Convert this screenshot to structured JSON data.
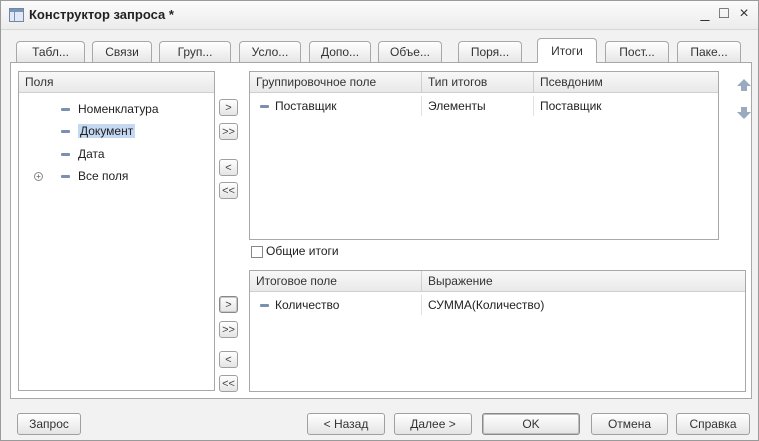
{
  "window": {
    "title": "Конструктор запроса *",
    "controls": {
      "minimize": "_",
      "maximize": "□",
      "close": "×"
    }
  },
  "tabs": [
    {
      "label": "Табл..."
    },
    {
      "label": "Связи"
    },
    {
      "label": "Груп..."
    },
    {
      "label": "Усло..."
    },
    {
      "label": "Допо..."
    },
    {
      "label": "Объе..."
    },
    {
      "label": "Поря..."
    },
    {
      "label": "Итоги"
    },
    {
      "label": "Пост..."
    },
    {
      "label": "Паке..."
    }
  ],
  "active_tab": "Итоги",
  "fields_panel": {
    "header": "Поля",
    "items": [
      {
        "label": "Номенклатура",
        "icon": "field-icon"
      },
      {
        "label": "Документ",
        "icon": "field-icon",
        "selected": true
      },
      {
        "label": "Дата",
        "icon": "field-icon"
      },
      {
        "label": "Все поля",
        "icon": "field-icon",
        "expandable": true
      }
    ]
  },
  "move_buttons_top": [
    {
      "label": ">",
      "action": "move-one"
    },
    {
      "label": ">>",
      "action": "move-all"
    },
    {
      "label": "<",
      "action": "remove-one"
    },
    {
      "label": "<<",
      "action": "remove-all"
    }
  ],
  "move_buttons_bottom": [
    {
      "label": ">",
      "action": "move-one"
    },
    {
      "label": ">>",
      "action": "move-all"
    },
    {
      "label": "<",
      "action": "remove-one"
    },
    {
      "label": "<<",
      "action": "remove-all"
    }
  ],
  "grouping_table": {
    "columns": [
      "Группировочное поле",
      "Тип итогов",
      "Псевдоним"
    ],
    "rows": [
      {
        "field": "Поставщик",
        "type": "Элементы",
        "alias": "Поставщик"
      }
    ]
  },
  "order_arrows": {
    "up": "arrow-up-icon",
    "down": "arrow-down-icon"
  },
  "general_totals": {
    "label": "Общие итоги",
    "checked": false
  },
  "totals_table": {
    "columns": [
      "Итоговое поле",
      "Выражение"
    ],
    "rows": [
      {
        "field": "Количество",
        "expression": "СУММА(Количество)"
      }
    ]
  },
  "footer_buttons": {
    "query": "Запрос",
    "back": "< Назад",
    "next": "Далее >",
    "ok": "OK",
    "cancel": "Отмена",
    "help": "Справка"
  },
  "colors": {
    "selection": "#c4d8f2",
    "field_icon": "#7b8fb0",
    "arrow": "#9aaabf"
  }
}
